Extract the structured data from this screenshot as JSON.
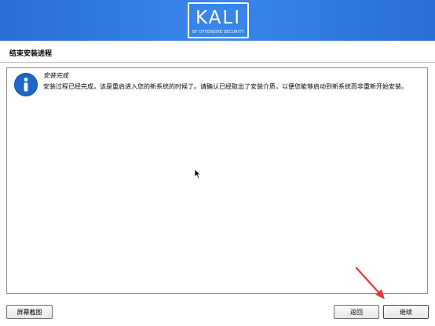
{
  "header": {
    "logo_text": "KALI",
    "logo_subtext": "BY OFFENSIVE SECURITY",
    "background_color": "#3a86ea"
  },
  "step": {
    "title": "结束安装进程"
  },
  "message": {
    "icon": "info-icon",
    "title": "安装完成",
    "body": "安装过程已经完成，该是重启进入您的新系统的时候了。请确认已经取出了安装介质，以便您能够启动到新系统而非重新开始安装。"
  },
  "buttons": {
    "screenshot_label": "屏幕截图",
    "back_label": "返回",
    "continue_label": "继续"
  },
  "annotation": {
    "arrow_color": "#e53935"
  }
}
